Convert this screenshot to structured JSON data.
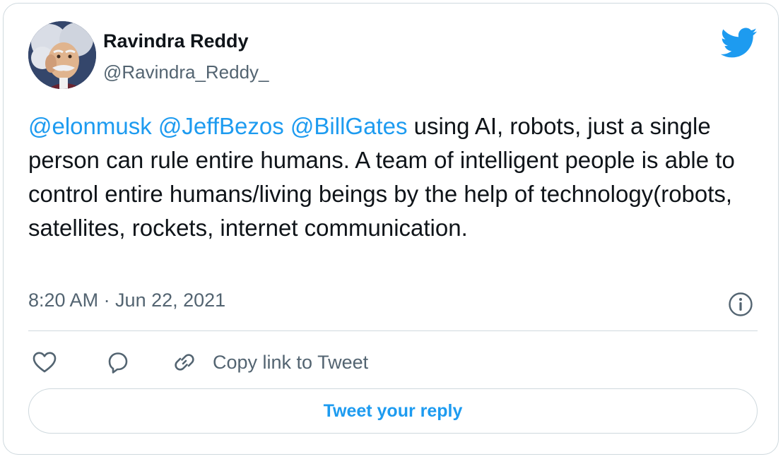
{
  "author": {
    "name": "Ravindra Reddy",
    "handle": "@Ravindra_Reddy_"
  },
  "tweet": {
    "mentions": [
      "@elonmusk",
      "@JeffBezos",
      "@BillGates"
    ],
    "body": "using AI, robots, just a single person can rule entire humans. A team of intelligent people is able to control entire humans/living beings by the help of technology(robots, satellites, rockets, internet communication.",
    "timestamp": "8:20 AM · Jun 22, 2021"
  },
  "actions": {
    "copy_link_label": "Copy link to Tweet",
    "reply_button_label": "Tweet your reply"
  },
  "icons": {
    "brand": "twitter-bird-icon",
    "like": "heart-icon",
    "reply": "speech-bubble-icon",
    "copy": "link-icon",
    "info": "info-icon"
  },
  "colors": {
    "accent": "#1d9bf0",
    "text": "#0f1419",
    "secondary": "#536471",
    "border": "#cfd9de"
  }
}
